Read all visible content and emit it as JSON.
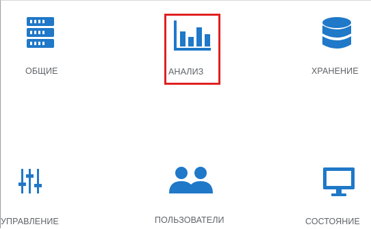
{
  "colors": {
    "icon": "#1f78c8",
    "label": "#5f6368",
    "highlight": "#e02020",
    "border": "#9a9a9a"
  },
  "tiles": [
    {
      "id": "general",
      "label": "ОБЩИЕ",
      "icon": "server-icon"
    },
    {
      "id": "analysis",
      "label": "АНАЛИЗ",
      "icon": "bar-chart-icon",
      "highlighted": true
    },
    {
      "id": "storage",
      "label": "ХРАНЕНИЕ",
      "icon": "database-icon"
    },
    {
      "id": "management",
      "label": "УПРАВЛЕНИЕ",
      "icon": "sliders-icon"
    },
    {
      "id": "users",
      "label": "ПОЛЬЗОВАТЕЛИ",
      "icon": "users-icon"
    },
    {
      "id": "status",
      "label": "СОСТОЯНИЕ",
      "icon": "monitor-icon"
    }
  ]
}
